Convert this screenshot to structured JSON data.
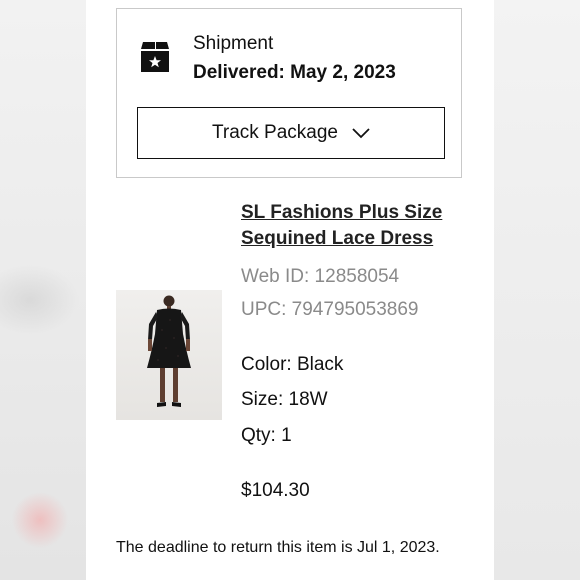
{
  "shipment": {
    "label": "Shipment",
    "status": "Delivered: May 2, 2023",
    "track_button": "Track Package",
    "icon": "box-star-icon",
    "chevron_icon": "chevron-down-icon"
  },
  "product": {
    "title": "SL Fashions Plus Size Sequined Lace Dress",
    "web_id": "Web ID: 12858054",
    "upc": "UPC: 794795053869",
    "color": "Color: Black",
    "size": "Size: 18W",
    "qty": "Qty: 1",
    "price": "$104.30",
    "image": "product-dress-image"
  },
  "return_note": "The deadline to return this item is Jul 1, 2023."
}
